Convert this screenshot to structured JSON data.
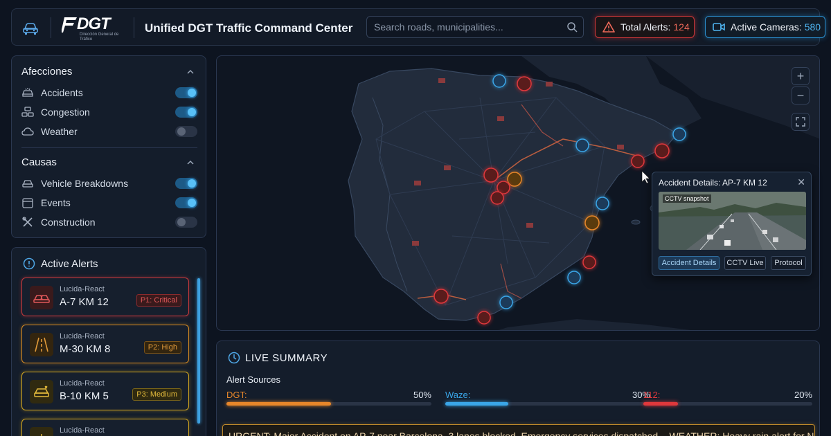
{
  "header": {
    "logo_text": "DGT",
    "logo_subtitle": "Dirección General de Tráfico",
    "title": "Unified DGT Traffic Command Center",
    "search_placeholder": "Search roads, municipalities...",
    "alerts_label": "Total Alerts:",
    "alerts_value": "124",
    "cameras_label": "Active Cameras:",
    "cameras_value": "580"
  },
  "filters": {
    "afecciones_title": "Afecciones",
    "afecciones": [
      {
        "label": "Accidents",
        "on": true,
        "icon": "car-crash-icon"
      },
      {
        "label": "Congestion",
        "on": true,
        "icon": "traffic-icon"
      },
      {
        "label": "Weather",
        "on": false,
        "icon": "cloud-icon"
      }
    ],
    "causas_title": "Causas",
    "causas": [
      {
        "label": "Vehicle Breakdowns",
        "on": true,
        "icon": "car-icon"
      },
      {
        "label": "Events",
        "on": true,
        "icon": "calendar-icon"
      },
      {
        "label": "Construction",
        "on": false,
        "icon": "tools-icon"
      }
    ]
  },
  "alerts": {
    "title": "Active Alerts",
    "items": [
      {
        "source": "Lucida-React",
        "location": "A-7 KM 12",
        "priority": "P1: Critical",
        "level": "red",
        "icon": "car-crash-icon"
      },
      {
        "source": "Lucida-React",
        "location": "M-30 KM 8",
        "priority": "P2: High",
        "level": "orange",
        "icon": "road-icon"
      },
      {
        "source": "Lucida-React",
        "location": "B-10 KM 5",
        "priority": "P3: Medium",
        "level": "yellow",
        "icon": "car-crash-icon"
      },
      {
        "source": "Lucida-React",
        "location": "",
        "priority": "",
        "level": "yellow",
        "icon": "sun-icon"
      }
    ]
  },
  "popup": {
    "title": "Accident Details: AP-7 KM 12",
    "snapshot_label": "CCTV snapshot",
    "buttons": [
      "Accident Details",
      "CCTV Live",
      "Protocol"
    ]
  },
  "summary": {
    "title": "LIVE SUMMARY",
    "sources_label": "Alert Sources",
    "sources": [
      {
        "name": "DGT:",
        "percent": "50%",
        "value": 0.5,
        "color": "#e8872a"
      },
      {
        "name": "Waze:",
        "percent": "30%",
        "value": 0.3,
        "color": "#3aa6e8"
      },
      {
        "name": "112:",
        "percent": "20%",
        "value": 0.2,
        "color": "#e0383c"
      }
    ],
    "ticker": "URGENT: Major Accident on AP-7 near Barcelona. 3 lanes blocked. Emergency services dispatched. - WEATHER: Heavy rain alert for Northern sector"
  },
  "colors": {
    "red": "#e0383c",
    "orange": "#e8872a",
    "yellow": "#d8a828",
    "blue": "#3aa6e8"
  }
}
